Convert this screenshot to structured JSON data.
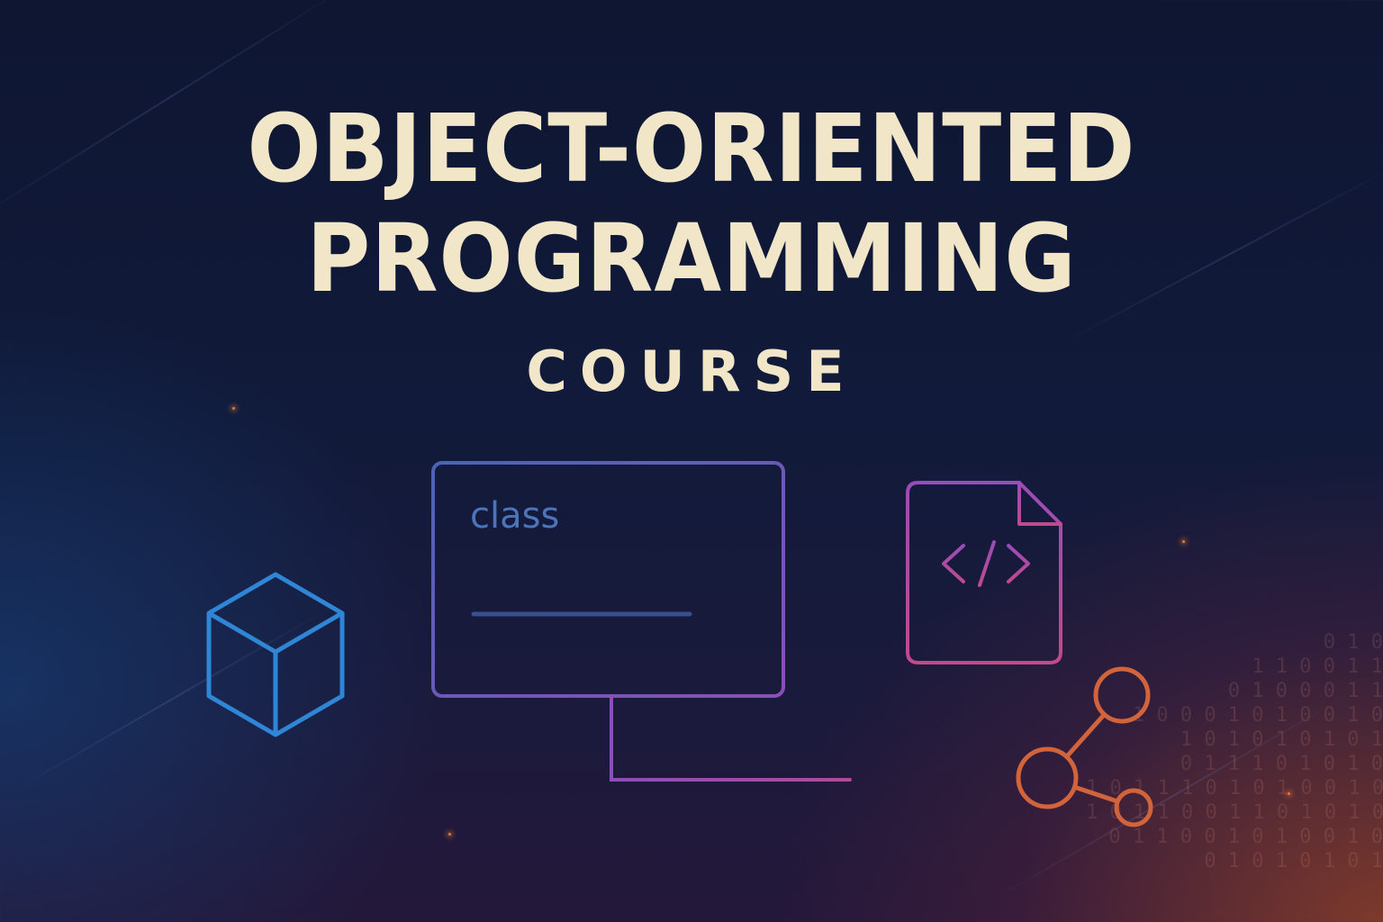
{
  "title": {
    "line1": "OBJECT-ORIENTED",
    "line2": "PROGRAMMING",
    "subtitle": "COURSE"
  },
  "class_card": {
    "label": "class"
  },
  "icons": {
    "cube": "cube-icon",
    "code_file": "code-file-icon",
    "share": "share-nodes-icon"
  },
  "colors": {
    "title_text": "#f2e6c8",
    "cube_blue": "#2f86d6",
    "card_blue": "#4a64b8",
    "card_purple": "#8a4fb8",
    "file_magenta": "#b04aa8",
    "share_orange": "#d2643c"
  },
  "binary_text": "0 1 0\n1 1 0 0 1 1\n0 1 0 0 0 1 1\n1 0 0 0 1 0 1 0 0 1 0\n1 0 1 0 1 0 1 0 1\n0 1 1 1 0 1 0 1 0\n1 0 1 1 1 0 1 0 1 0 0 1 0\n1 0 1 1 0 0 1 1 0 1 0 1 0\n0 1 1 0 0 1 0 1 0 0 1 0\n0 1 0 1 0 1 0 1"
}
